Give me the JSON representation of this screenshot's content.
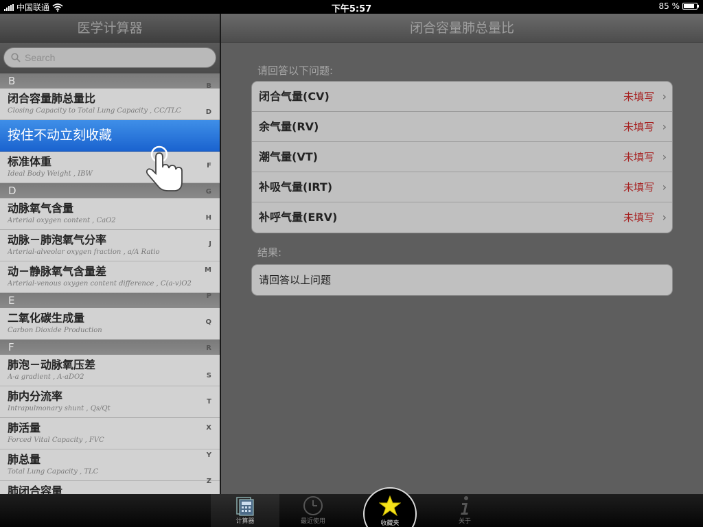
{
  "statusbar": {
    "carrier": "中国联通",
    "time": "下午5:57",
    "battery": "85 %"
  },
  "left": {
    "title": "医学计算器",
    "search_placeholder": "Search",
    "sections": [
      {
        "letter": "B",
        "rows": [
          {
            "title": "闭合容量肺总量比",
            "sub": "Closing Capacity to Total Lung Capacity , CC/TLC"
          },
          {
            "title": "按住不动立刻收藏",
            "sub": "",
            "highlight": true
          },
          {
            "title": "标准体重",
            "sub": "Ideal Body Weight , IBW"
          }
        ]
      },
      {
        "letter": "D",
        "rows": [
          {
            "title": "动脉氧气含量",
            "sub": "Arterial oxygen content , CaO2"
          },
          {
            "title": "动脉－肺泡氧气分率",
            "sub": "Arterial-alveolar oxygen fraction , a/A Ratio"
          },
          {
            "title": "动－静脉氧气含量差",
            "sub": "Arterial-venous oxygen content difference , C(a-v)O2"
          }
        ]
      },
      {
        "letter": "E",
        "rows": [
          {
            "title": "二氧化碳生成量",
            "sub": "Carbon Dioxide Production"
          }
        ]
      },
      {
        "letter": "F",
        "rows": [
          {
            "title": "肺泡－动脉氧压差",
            "sub": "A-a gradient , A-aDO2"
          },
          {
            "title": "肺内分流率",
            "sub": "Intrapulmonary shunt , Qs/Qt"
          },
          {
            "title": "肺活量",
            "sub": "Forced Vital Capacity , FVC"
          },
          {
            "title": "肺总量",
            "sub": "Total Lung Capacity , TLC"
          },
          {
            "title": "肺闭合容量",
            "sub": ""
          }
        ]
      }
    ],
    "index_letters": [
      "B",
      "D",
      "F",
      "G",
      "H",
      "J",
      "M",
      "P",
      "Q",
      "R",
      "S",
      "T",
      "X",
      "Y",
      "Z"
    ]
  },
  "right": {
    "title": "闭合容量肺总量比",
    "questions_label": "请回答以下问题:",
    "questions": [
      {
        "label": "闭合气量(CV)",
        "status": "未填写"
      },
      {
        "label": "余气量(RV)",
        "status": "未填写"
      },
      {
        "label": "潮气量(VT)",
        "status": "未填写"
      },
      {
        "label": "补吸气量(IRT)",
        "status": "未填写"
      },
      {
        "label": "补呼气量(ERV)",
        "status": "未填写"
      }
    ],
    "result_label": "结果:",
    "result_text": "请回答以上问题"
  },
  "tabbar": {
    "tabs": [
      {
        "label": "计算器",
        "icon": "calculator-icon"
      },
      {
        "label": "最近使用",
        "icon": "clock-icon"
      },
      {
        "label": "收藏夹",
        "icon": "star-icon"
      },
      {
        "label": "关于",
        "icon": "info-icon"
      }
    ]
  },
  "colors": {
    "highlight": "#2a74dd",
    "status_red": "#a72020",
    "star": "#f5e21a"
  }
}
